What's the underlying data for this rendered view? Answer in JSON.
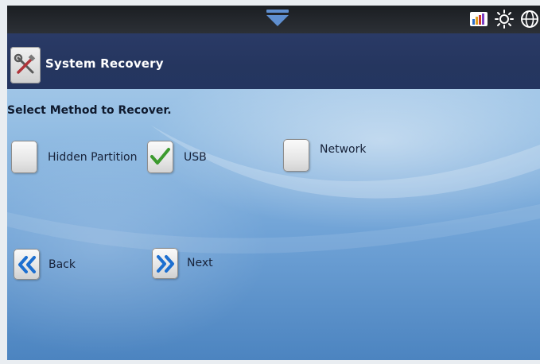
{
  "header": {
    "title": "System Recovery",
    "app_icon": "tools-icon"
  },
  "status_bar": {
    "icons": [
      "signal-bars-icon",
      "brightness-icon",
      "globe-icon"
    ]
  },
  "main": {
    "instruction": "Select Method to Recover.",
    "options": [
      {
        "label": "Hidden Partition",
        "checked": false
      },
      {
        "label": "USB",
        "checked": true
      },
      {
        "label": "Network",
        "checked": false
      }
    ]
  },
  "navigation": {
    "back_label": "Back",
    "next_label": "Next"
  },
  "colors": {
    "title_bar": "#25365f",
    "check_green": "#3c9a2e",
    "nav_arrow_blue": "#1d6fd0"
  }
}
